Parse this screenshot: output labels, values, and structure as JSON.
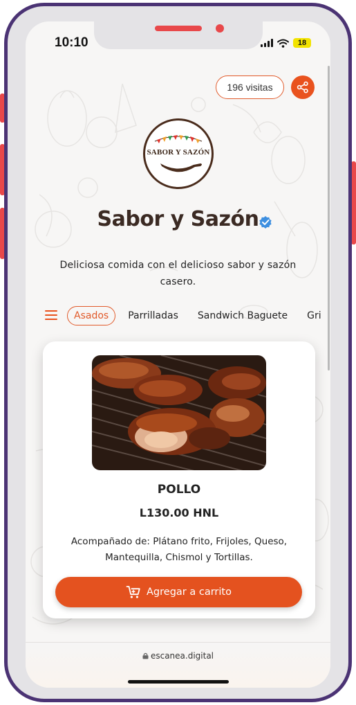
{
  "status_bar": {
    "time": "10:10",
    "battery": "18"
  },
  "header": {
    "visits": "196 visitas",
    "share_icon": "share-icon"
  },
  "restaurant": {
    "logo_text": "SABOR Y SAZÓN",
    "name": "Sabor y Sazón",
    "verified_icon": "verified-badge-icon",
    "description": "Deliciosa comida con el delicioso sabor y sazón casero."
  },
  "categories": {
    "menu_icon": "hamburger-menu-icon",
    "items": [
      "Asados",
      "Parrilladas",
      "Sandwich Baguete",
      "Gri"
    ],
    "active_index": 0
  },
  "product": {
    "name": "POLLO",
    "price": "L130.00 HNL",
    "description": "Acompañado de: Plátano frito, Frijoles, Queso, Mantequilla, Chismol y Tortillas.",
    "button_label": "Agregar a carrito",
    "cart_icon": "cart-icon"
  },
  "browser": {
    "url": "escanea.digital",
    "lock_icon": "lock-icon"
  },
  "colors": {
    "accent": "#e9521e",
    "frame": "#4b3374",
    "side_buttons": "#e8484a",
    "verified": "#3d8fe0"
  }
}
